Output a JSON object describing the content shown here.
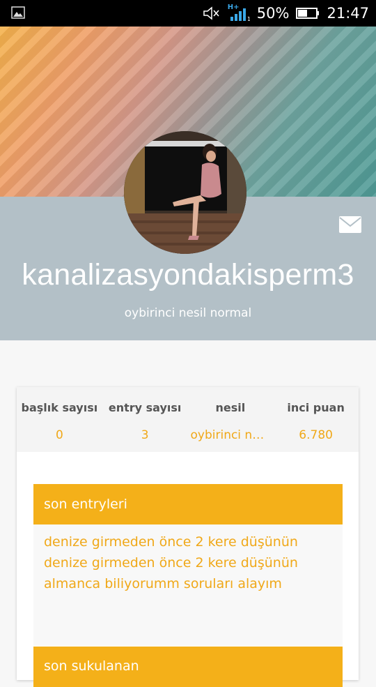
{
  "status_bar": {
    "battery": "50%",
    "time": "21:47",
    "network": "H+"
  },
  "profile": {
    "username": "kanalizasyondakisperm3",
    "subtitle": "oybirinci nesil normal"
  },
  "stats": [
    {
      "label": "başlık sayısı",
      "value": "0"
    },
    {
      "label": "entry sayısı",
      "value": "3"
    },
    {
      "label": "nesil",
      "value": "oybirinci ne..."
    },
    {
      "label": "inci puan",
      "value": "6.780"
    }
  ],
  "sections": {
    "latest_entries": {
      "title": "son entryleri",
      "items": [
        "denize girmeden önce 2 kere düşünün",
        "denize girmeden önce 2 kere düşünün",
        "almanca biliyorumm soruları alayım"
      ]
    },
    "latest_favorites": {
      "title": "son sukulanan"
    }
  },
  "colors": {
    "accent": "#f4b019",
    "link": "#f0a818",
    "profile_band": "#b3c0c7"
  }
}
